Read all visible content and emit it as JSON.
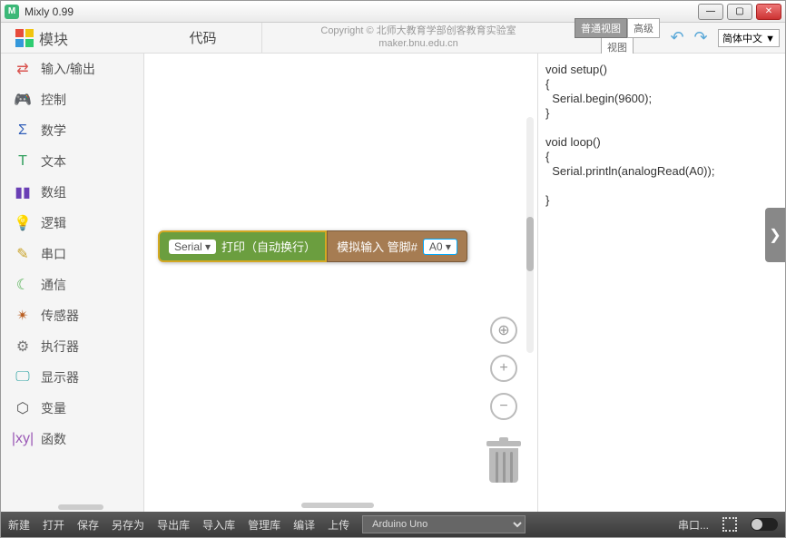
{
  "window": {
    "title": "Mixly 0.99"
  },
  "header": {
    "modules_label": "模块",
    "code_tab": "代码",
    "copyright_line1": "Copyright © 北师大教育学部创客教育实验室",
    "copyright_line2": "maker.bnu.edu.cn",
    "view_normal": "普通视图",
    "view_advanced": "高级",
    "view_sub": "视图",
    "language": "简体中文 ▼"
  },
  "categories": [
    {
      "label": "输入/输出",
      "icon": "⇄",
      "color": "#d9534f"
    },
    {
      "label": "控制",
      "icon": "🎮",
      "color": "#5bc0de"
    },
    {
      "label": "数学",
      "icon": "Σ",
      "color": "#2e5cb8"
    },
    {
      "label": "文本",
      "icon": "T",
      "color": "#2e9e5b"
    },
    {
      "label": "数组",
      "icon": "▮▮",
      "color": "#6a3fb5"
    },
    {
      "label": "逻辑",
      "icon": "💡",
      "color": "#3a87ad"
    },
    {
      "label": "串口",
      "icon": "✎",
      "color": "#c9a227"
    },
    {
      "label": "通信",
      "icon": "☾",
      "color": "#4cae4c"
    },
    {
      "label": "传感器",
      "icon": "✴",
      "color": "#b85c1e"
    },
    {
      "label": "执行器",
      "icon": "⚙",
      "color": "#777"
    },
    {
      "label": "显示器",
      "icon": "🖵",
      "color": "#2fa4a4"
    },
    {
      "label": "变量",
      "icon": "⬡",
      "color": "#555"
    },
    {
      "label": "函数",
      "icon": "|xy|",
      "color": "#9b59b6"
    }
  ],
  "block": {
    "serial_dd": "Serial ▾",
    "serial_text": "打印（自动换行）",
    "analog_text": "模拟输入 管脚#",
    "analog_dd": "A0 ▾"
  },
  "code": "void setup()\n{\n  Serial.begin(9600);\n}\n\nvoid loop()\n{\n  Serial.println(analogRead(A0));\n\n}",
  "bottom": {
    "new": "新建",
    "open": "打开",
    "save": "保存",
    "saveas": "另存为",
    "exportlib": "导出库",
    "importlib": "导入库",
    "managelib": "管理库",
    "compile": "编译",
    "upload": "上传",
    "board": "Arduino Uno",
    "serial": "串口..."
  }
}
